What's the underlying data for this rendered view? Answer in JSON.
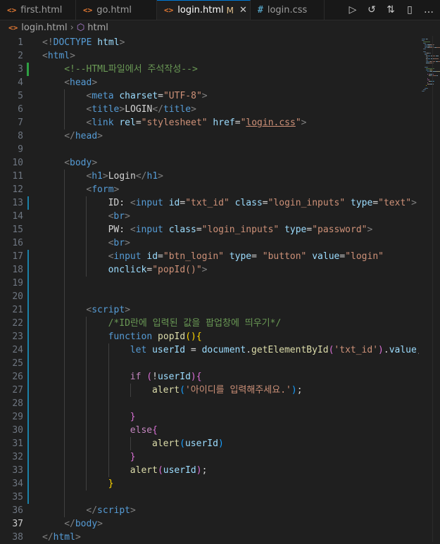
{
  "tabs": [
    {
      "label": "first.html",
      "type": "html",
      "active": false
    },
    {
      "label": "go.html",
      "type": "html",
      "active": false
    },
    {
      "label": "login.html",
      "type": "html",
      "active": true,
      "modified": "M"
    },
    {
      "label": "login.css",
      "type": "css",
      "active": false,
      "unsaved": true
    }
  ],
  "tab_icons": {
    "html": "<>",
    "css": "#"
  },
  "actions": [
    {
      "name": "run-icon",
      "glyph": "▷"
    },
    {
      "name": "timeline-icon",
      "glyph": "↺"
    },
    {
      "name": "source-control-icon",
      "glyph": "⇅"
    },
    {
      "name": "split-editor-icon",
      "glyph": "▯"
    },
    {
      "name": "more-icon",
      "glyph": "…"
    }
  ],
  "breadcrumb": {
    "file": "login.html",
    "separator": "›",
    "element": "html"
  },
  "colors": {
    "accent": "#0078d4",
    "modified": "#e2c08d",
    "gutter_added": "#2ea043",
    "gutter_modified": "#1b81a8"
  },
  "active_line": 37,
  "lines": [
    {
      "n": "1",
      "gutter": "",
      "indent": 0,
      "tokens": [
        [
          "punct",
          "<!"
        ],
        [
          "tag",
          "DOCTYPE"
        ],
        [
          "text",
          " "
        ],
        [
          "attr",
          "html"
        ],
        [
          "punct",
          ">"
        ]
      ]
    },
    {
      "n": "2",
      "gutter": "",
      "indent": 0,
      "tokens": [
        [
          "punct",
          "<"
        ],
        [
          "tag",
          "html"
        ],
        [
          "punct",
          ">"
        ]
      ]
    },
    {
      "n": "3",
      "gutter": "add",
      "indent": 1,
      "tokens": [
        [
          "comment",
          "<!--HTML파일에서 주석작성-->"
        ]
      ]
    },
    {
      "n": "4",
      "gutter": "",
      "indent": 1,
      "tokens": [
        [
          "punct",
          "<"
        ],
        [
          "tag",
          "head"
        ],
        [
          "punct",
          ">"
        ]
      ]
    },
    {
      "n": "5",
      "gutter": "",
      "indent": 2,
      "tokens": [
        [
          "punct",
          "<"
        ],
        [
          "tag",
          "meta"
        ],
        [
          "text",
          " "
        ],
        [
          "attr",
          "charset"
        ],
        [
          "text",
          "="
        ],
        [
          "str",
          "\"UTF-8\""
        ],
        [
          "punct",
          ">"
        ]
      ]
    },
    {
      "n": "6",
      "gutter": "",
      "indent": 2,
      "tokens": [
        [
          "punct",
          "<"
        ],
        [
          "tag",
          "title"
        ],
        [
          "punct",
          ">"
        ],
        [
          "text",
          "LOGIN"
        ],
        [
          "punct",
          "</"
        ],
        [
          "tag",
          "title"
        ],
        [
          "punct",
          ">"
        ]
      ]
    },
    {
      "n": "7",
      "gutter": "",
      "indent": 2,
      "tokens": [
        [
          "punct",
          "<"
        ],
        [
          "tag",
          "link"
        ],
        [
          "text",
          " "
        ],
        [
          "attr",
          "rel"
        ],
        [
          "text",
          "="
        ],
        [
          "str",
          "\"stylesheet\""
        ],
        [
          "text",
          " "
        ],
        [
          "attr",
          "href"
        ],
        [
          "text",
          "="
        ],
        [
          "str",
          "\""
        ],
        [
          "link",
          "login.css"
        ],
        [
          "str",
          "\""
        ],
        [
          "punct",
          ">"
        ]
      ]
    },
    {
      "n": "8",
      "gutter": "",
      "indent": 1,
      "tokens": [
        [
          "punct",
          "</"
        ],
        [
          "tag",
          "head"
        ],
        [
          "punct",
          ">"
        ]
      ]
    },
    {
      "n": "9",
      "gutter": "",
      "indent": 0,
      "tokens": []
    },
    {
      "n": "10",
      "gutter": "",
      "indent": 1,
      "tokens": [
        [
          "punct",
          "<"
        ],
        [
          "tag",
          "body"
        ],
        [
          "punct",
          ">"
        ]
      ]
    },
    {
      "n": "11",
      "gutter": "",
      "indent": 2,
      "tokens": [
        [
          "punct",
          "<"
        ],
        [
          "tag",
          "h1"
        ],
        [
          "punct",
          ">"
        ],
        [
          "text",
          "Login"
        ],
        [
          "punct",
          "</"
        ],
        [
          "tag",
          "h1"
        ],
        [
          "punct",
          ">"
        ]
      ]
    },
    {
      "n": "12",
      "gutter": "",
      "indent": 2,
      "tokens": [
        [
          "punct",
          "<"
        ],
        [
          "tag",
          "form"
        ],
        [
          "punct",
          ">"
        ]
      ]
    },
    {
      "n": "13",
      "gutter": "mod",
      "indent": 3,
      "tokens": [
        [
          "text",
          "ID: "
        ],
        [
          "punct",
          "<"
        ],
        [
          "tag",
          "input"
        ],
        [
          "text",
          " "
        ],
        [
          "attr",
          "id"
        ],
        [
          "text",
          "="
        ],
        [
          "str",
          "\"txt_id\""
        ],
        [
          "text",
          " "
        ],
        [
          "attr",
          "class"
        ],
        [
          "text",
          "="
        ],
        [
          "str",
          "\"login_inputs\""
        ],
        [
          "text",
          " "
        ],
        [
          "attr",
          "type"
        ],
        [
          "text",
          "="
        ],
        [
          "str",
          "\"text\""
        ],
        [
          "punct",
          ">"
        ]
      ]
    },
    {
      "n": "14",
      "gutter": "",
      "indent": 3,
      "tokens": [
        [
          "punct",
          "<"
        ],
        [
          "tag",
          "br"
        ],
        [
          "punct",
          ">"
        ]
      ]
    },
    {
      "n": "15",
      "gutter": "",
      "indent": 3,
      "tokens": [
        [
          "text",
          "PW: "
        ],
        [
          "punct",
          "<"
        ],
        [
          "tag",
          "input"
        ],
        [
          "text",
          " "
        ],
        [
          "attr",
          "class"
        ],
        [
          "text",
          "="
        ],
        [
          "str",
          "\"login_inputs\""
        ],
        [
          "text",
          " "
        ],
        [
          "attr",
          "type"
        ],
        [
          "text",
          "="
        ],
        [
          "str",
          "\"password\""
        ],
        [
          "punct",
          ">"
        ]
      ]
    },
    {
      "n": "16",
      "gutter": "",
      "indent": 3,
      "tokens": [
        [
          "punct",
          "<"
        ],
        [
          "tag",
          "br"
        ],
        [
          "punct",
          ">"
        ]
      ]
    },
    {
      "n": "17",
      "gutter": "mod",
      "indent": 3,
      "tokens": [
        [
          "punct",
          "<"
        ],
        [
          "tag",
          "input"
        ],
        [
          "text",
          " "
        ],
        [
          "attr",
          "id"
        ],
        [
          "text",
          "="
        ],
        [
          "str",
          "\"btn_login\""
        ],
        [
          "text",
          " "
        ],
        [
          "attr",
          "type"
        ],
        [
          "text",
          "= "
        ],
        [
          "str",
          "\"button\""
        ],
        [
          "text",
          " "
        ],
        [
          "attr",
          "value"
        ],
        [
          "text",
          "="
        ],
        [
          "str",
          "\"login\""
        ]
      ]
    },
    {
      "n": "18",
      "gutter": "mod",
      "indent": 3,
      "tokens": [
        [
          "attr",
          "onclick"
        ],
        [
          "text",
          "="
        ],
        [
          "str",
          "\"popId()\""
        ],
        [
          "punct",
          ">"
        ]
      ]
    },
    {
      "n": "19",
      "gutter": "mod",
      "indent": 0,
      "tokens": []
    },
    {
      "n": "20",
      "gutter": "mod",
      "indent": 0,
      "tokens": []
    },
    {
      "n": "21",
      "gutter": "mod",
      "indent": 2,
      "tokens": [
        [
          "punct",
          "<"
        ],
        [
          "tag",
          "script"
        ],
        [
          "punct",
          ">"
        ]
      ]
    },
    {
      "n": "22",
      "gutter": "mod",
      "indent": 3,
      "tokens": [
        [
          "comment",
          "/*ID란에 입력된 값을 팝업창에 띄우기*/"
        ]
      ]
    },
    {
      "n": "23",
      "gutter": "mod",
      "indent": 3,
      "tokens": [
        [
          "kw",
          "function"
        ],
        [
          "text",
          " "
        ],
        [
          "fn",
          "popId"
        ],
        [
          "brace1",
          "()"
        ],
        [
          "brace1",
          "{"
        ]
      ]
    },
    {
      "n": "24",
      "gutter": "mod",
      "indent": 4,
      "tokens": [
        [
          "kw",
          "let"
        ],
        [
          "text",
          " "
        ],
        [
          "var",
          "userId"
        ],
        [
          "text",
          " = "
        ],
        [
          "var",
          "document"
        ],
        [
          "text",
          "."
        ],
        [
          "fn",
          "getElementById"
        ],
        [
          "brace2",
          "("
        ],
        [
          "str",
          "'txt_id'"
        ],
        [
          "brace2",
          ")"
        ],
        [
          "text",
          "."
        ],
        [
          "var",
          "value"
        ],
        [
          "text",
          ";"
        ]
      ]
    },
    {
      "n": "25",
      "gutter": "mod",
      "indent": 0,
      "tokens": []
    },
    {
      "n": "26",
      "gutter": "mod",
      "indent": 4,
      "tokens": [
        [
          "ctrl",
          "if"
        ],
        [
          "text",
          " "
        ],
        [
          "brace2",
          "("
        ],
        [
          "text",
          "!"
        ],
        [
          "var",
          "userId"
        ],
        [
          "brace2",
          ")"
        ],
        [
          "brace2",
          "{"
        ]
      ]
    },
    {
      "n": "27",
      "gutter": "mod",
      "indent": 5,
      "tokens": [
        [
          "fn",
          "alert"
        ],
        [
          "brace3",
          "("
        ],
        [
          "str",
          "'아이디를 입력해주세요.'"
        ],
        [
          "brace3",
          ")"
        ],
        [
          "text",
          ";"
        ]
      ]
    },
    {
      "n": "28",
      "gutter": "mod",
      "indent": 0,
      "tokens": []
    },
    {
      "n": "29",
      "gutter": "mod",
      "indent": 4,
      "tokens": [
        [
          "brace2",
          "}"
        ]
      ]
    },
    {
      "n": "30",
      "gutter": "mod",
      "indent": 4,
      "tokens": [
        [
          "ctrl",
          "else"
        ],
        [
          "brace2",
          "{"
        ]
      ]
    },
    {
      "n": "31",
      "gutter": "mod",
      "indent": 5,
      "tokens": [
        [
          "fn",
          "alert"
        ],
        [
          "brace3",
          "("
        ],
        [
          "var",
          "userId"
        ],
        [
          "brace3",
          ")"
        ]
      ]
    },
    {
      "n": "32",
      "gutter": "mod",
      "indent": 4,
      "tokens": [
        [
          "brace2",
          "}"
        ]
      ]
    },
    {
      "n": "33",
      "gutter": "mod",
      "indent": 4,
      "tokens": [
        [
          "fn",
          "alert"
        ],
        [
          "brace2",
          "("
        ],
        [
          "var",
          "userId"
        ],
        [
          "brace2",
          ")"
        ],
        [
          "text",
          ";"
        ]
      ]
    },
    {
      "n": "34",
      "gutter": "mod",
      "indent": 3,
      "tokens": [
        [
          "brace1",
          "}"
        ]
      ]
    },
    {
      "n": "35",
      "gutter": "mod",
      "indent": 0,
      "tokens": []
    },
    {
      "n": "36",
      "gutter": "",
      "indent": 2,
      "tokens": [
        [
          "punct",
          "</"
        ],
        [
          "tag",
          "script"
        ],
        [
          "punct",
          ">"
        ]
      ]
    },
    {
      "n": "37",
      "gutter": "",
      "indent": 1,
      "tokens": [
        [
          "punct",
          "</"
        ],
        [
          "tag",
          "body"
        ],
        [
          "punct",
          ">"
        ]
      ]
    },
    {
      "n": "38",
      "gutter": "",
      "indent": 0,
      "tokens": [
        [
          "punct",
          "</"
        ],
        [
          "tag",
          "html"
        ],
        [
          "punct",
          ">"
        ]
      ]
    }
  ]
}
